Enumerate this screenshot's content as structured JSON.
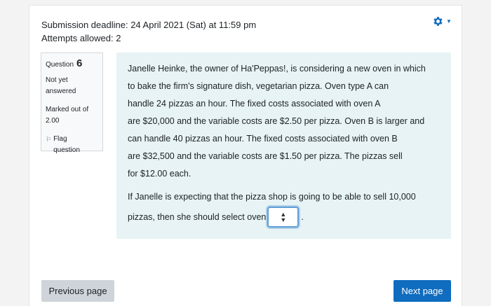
{
  "quiz": {
    "deadline": "Submission deadline: 24 April 2021 (Sat) at 11:59 pm",
    "attempts": "Attempts allowed: 2"
  },
  "question_info": {
    "label": "Question",
    "number": "6",
    "state_line1": "Not yet",
    "state_line2": "answered",
    "grade_line1": "Marked out of",
    "grade_line2": "2.00",
    "flag_line1": "Flag",
    "flag_line2": "question",
    "flag_icon": "flag-icon"
  },
  "question_text": {
    "lines": [
      "Janelle Heinke, the owner of Ha'Peppas!, is considering a new oven in which",
      "to bake the firm's signature dish, vegetarian pizza. Oven type A can",
      "handle 24 pizzas an hour. The fixed costs associated with oven A",
      "are $20,000 and the variable costs are $2.50 per pizza. Oven B is larger and",
      "can handle 40 pizzas an hour. The fixed costs associated with oven B",
      "are $32,500 and the variable costs are $1.50 per pizza. The pizzas sell",
      "for $12.00 each."
    ],
    "prompt_line1": "If Janelle is expecting that the pizza shop is going to be able to sell 10,000",
    "prompt_line2": "pizzas, then she should select oven",
    "answer_selected": "",
    "trailing": "."
  },
  "actions": {
    "previous": "Previous page",
    "next": "Next page"
  },
  "colors": {
    "accent": "#0f6cbf",
    "question_bg": "#e7f3f5",
    "secondary_button": "#ced4da"
  },
  "icons": {
    "settings": "gear-icon",
    "menu": "caret-down-icon",
    "select": "up-down-arrows-icon"
  }
}
